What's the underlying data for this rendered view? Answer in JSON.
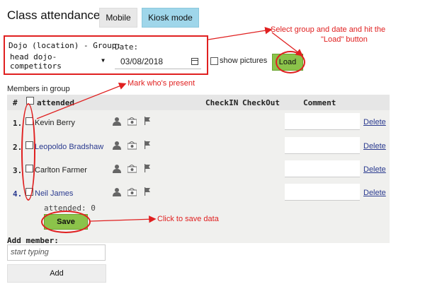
{
  "header": {
    "title": "Class attendance",
    "mobile_label": "Mobile",
    "kiosk_label": "Kiosk mode"
  },
  "filters": {
    "group_label": "Dojo (location) - Group:",
    "group_value": "head dojo-competitors",
    "date_label": "Date:",
    "date_value": "03/08/2018",
    "show_pictures_label": "show pictures",
    "load_label": "Load"
  },
  "members": {
    "section_label": "Members in group",
    "columns": {
      "hash": "#",
      "attended": "attended",
      "checkin": "CheckIN",
      "checkout": "CheckOut",
      "comment": "Comment"
    },
    "rows": [
      {
        "num": "1.",
        "name": "Kevin Berry",
        "delete": "Delete"
      },
      {
        "num": "2.",
        "name": "Leopoldo Bradshaw",
        "delete": "Delete"
      },
      {
        "num": "3.",
        "name": "Carlton Farmer",
        "delete": "Delete"
      },
      {
        "num": "4.",
        "name": "Neil James",
        "delete": "Delete"
      }
    ],
    "attended_count": "attended: 0",
    "save_label": "Save"
  },
  "add_member": {
    "label": "Add member:",
    "placeholder": "start typing",
    "add_label": "Add"
  },
  "annotations": {
    "select_hint_line1": "Select group and date and hit the",
    "select_hint_line2": "\"Load\" button",
    "present_hint": "Mark who's present",
    "save_hint": "Click to save data"
  },
  "colors": {
    "accent_green": "#8bc34a",
    "kiosk_blue": "#9fd6ea",
    "annotation_red": "#e02020",
    "link_blue": "#2a3a8f"
  }
}
